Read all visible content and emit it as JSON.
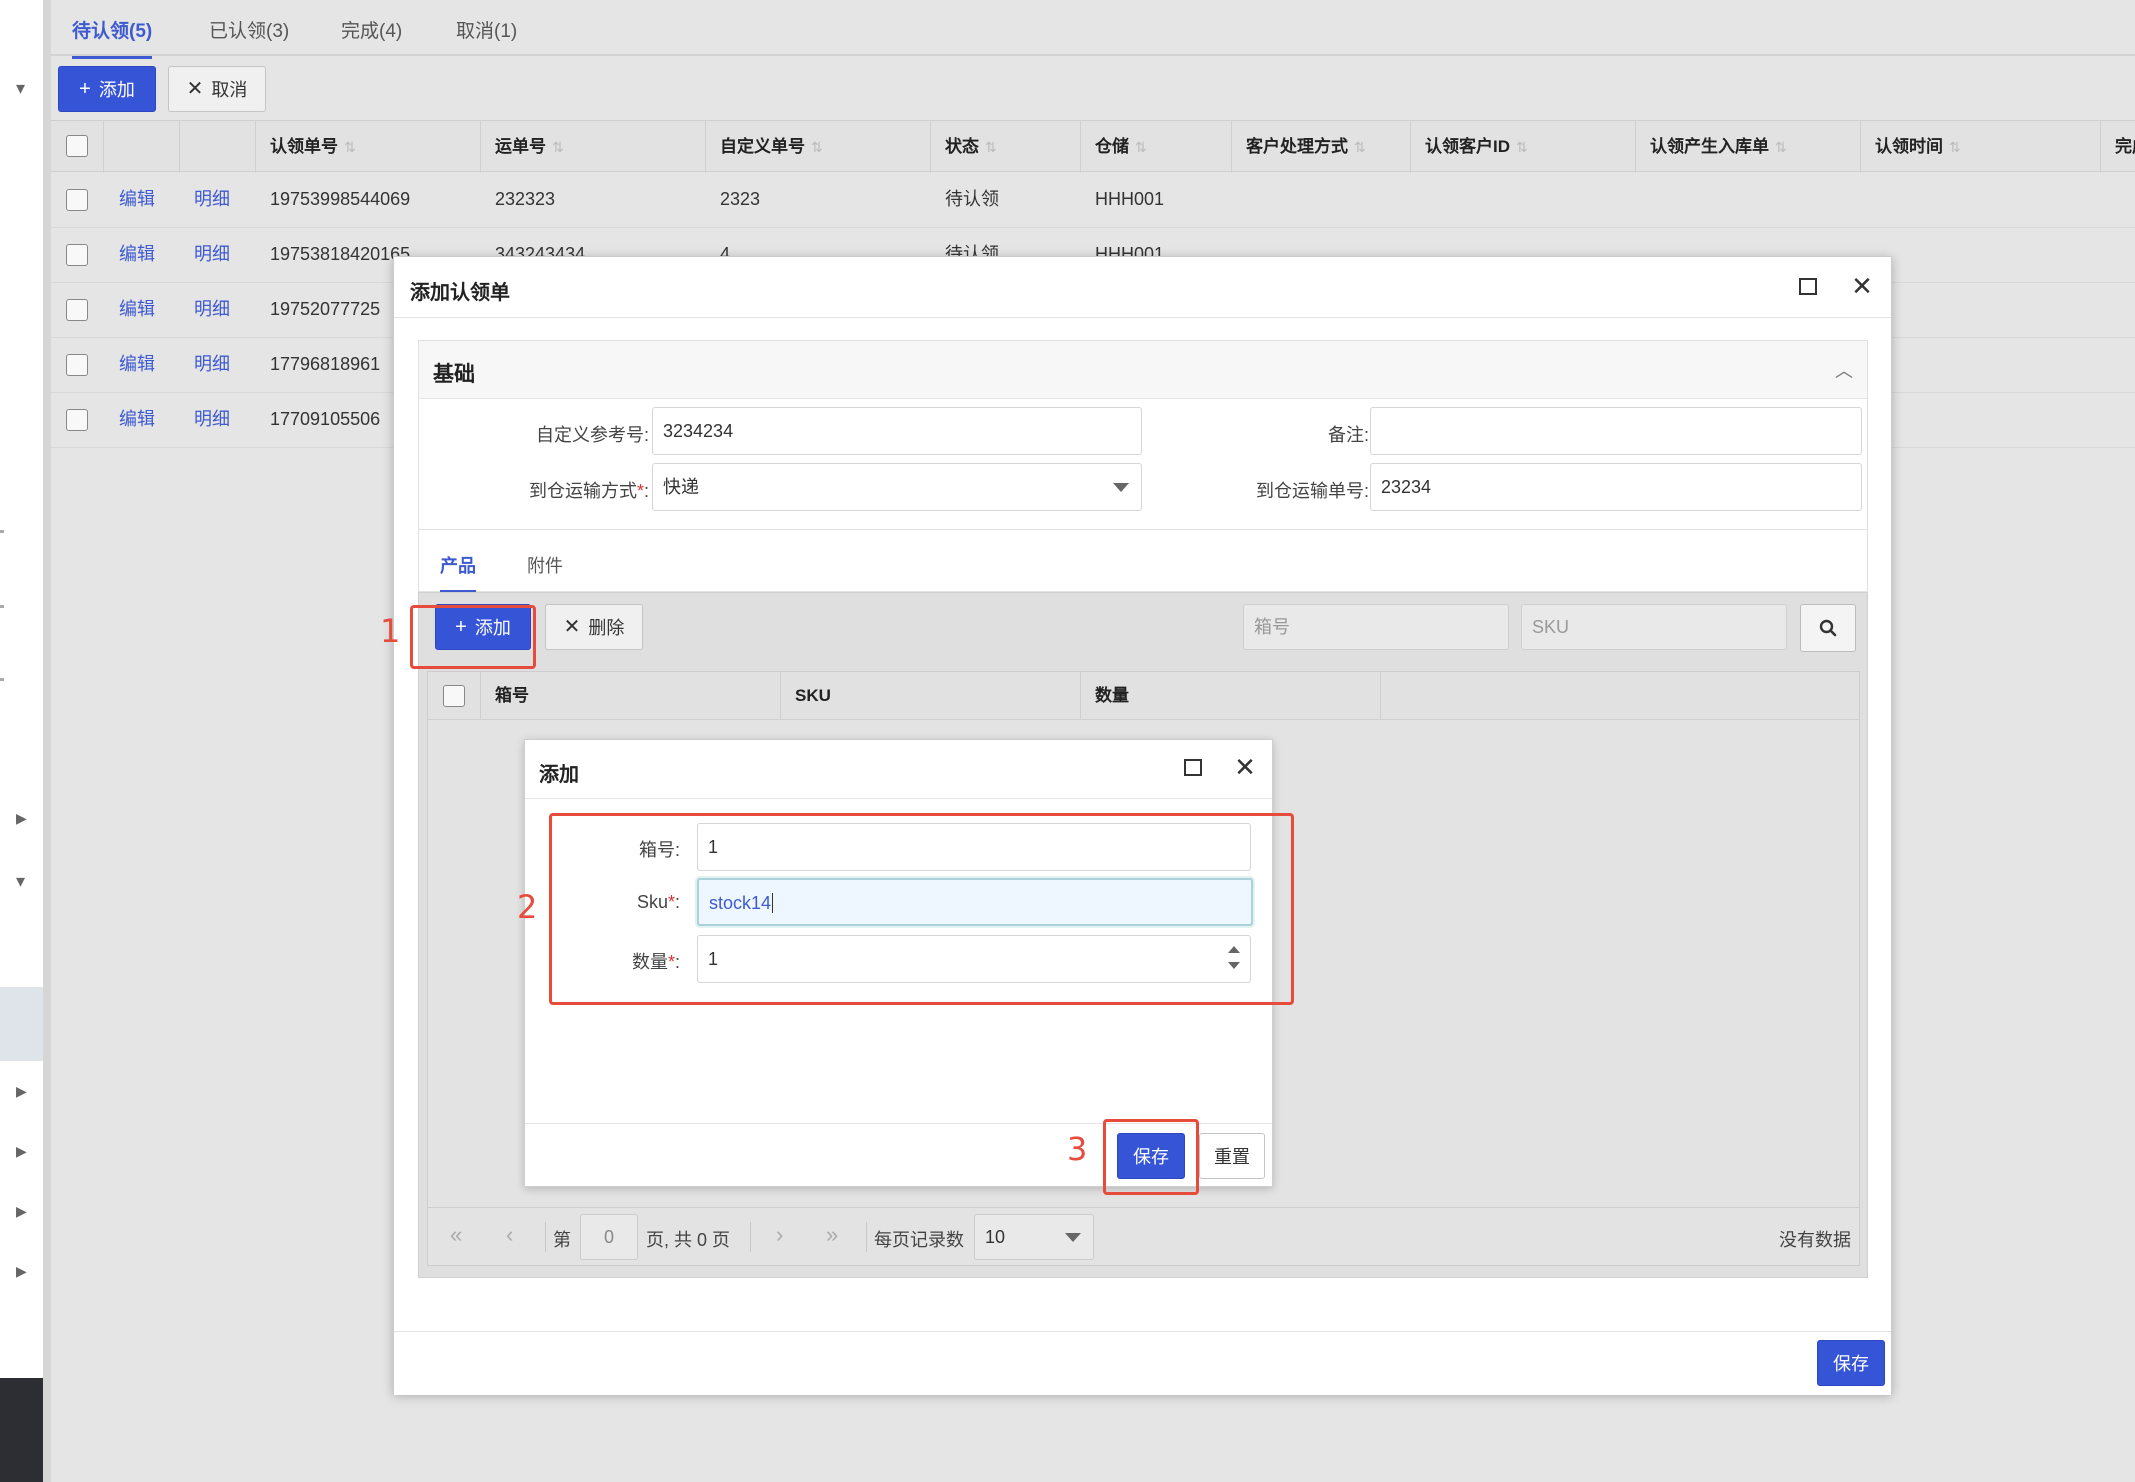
{
  "tabs": [
    {
      "label": "待认领(5)",
      "active": true
    },
    {
      "label": "已认领(3)",
      "active": false
    },
    {
      "label": "完成(4)",
      "active": false
    },
    {
      "label": "取消(1)",
      "active": false
    }
  ],
  "toolbar": {
    "add_label": "添加",
    "cancel_label": "取消"
  },
  "table": {
    "columns": [
      "认领单号",
      "运单号",
      "自定义单号",
      "状态",
      "仓储",
      "客户处理方式",
      "认领客户ID",
      "认领产生入库单",
      "认领时间",
      "完成"
    ],
    "edit_label": "编辑",
    "detail_label": "明细",
    "rows": [
      {
        "id": "19753998544069",
        "waybill": "232323",
        "custom": "2323",
        "status": "待认领",
        "warehouse": "HHH001"
      },
      {
        "id": "19753818420165",
        "waybill": "343243434",
        "custom": "4",
        "status": "待认领",
        "warehouse": "HHH001"
      },
      {
        "id": "19752077725",
        "waybill": "",
        "custom": "",
        "status": "",
        "warehouse": ""
      },
      {
        "id": "17796818961",
        "waybill": "",
        "custom": "",
        "status": "",
        "warehouse": ""
      },
      {
        "id": "17709105506",
        "waybill": "",
        "custom": "",
        "status": "",
        "warehouse": ""
      }
    ]
  },
  "modal": {
    "title": "添加认领单",
    "section_title": "基础",
    "fields": {
      "custom_ref_label": "自定义参考号:",
      "custom_ref_value": "3234234",
      "remark_label": "备注:",
      "remark_value": "",
      "transport_label": "到仓运输方式",
      "transport_value": "快递",
      "transport_no_label": "到仓运输单号:",
      "transport_no_value": "23234"
    },
    "tabs": [
      {
        "label": "产品",
        "active": true
      },
      {
        "label": "附件",
        "active": false
      }
    ],
    "product_toolbar": {
      "add_label": "添加",
      "delete_label": "删除",
      "box_placeholder": "箱号",
      "sku_placeholder": "SKU"
    },
    "product_columns": [
      "箱号",
      "SKU",
      "数量"
    ],
    "pager": {
      "page_prefix": "第",
      "page_value": "0",
      "page_suffix": "页, 共 0 页",
      "per_page_label": "每页记录数",
      "per_page_value": "10",
      "empty_text": "没有数据"
    },
    "save_label": "保存"
  },
  "dialog": {
    "title": "添加",
    "box_label": "箱号:",
    "box_value": "1",
    "sku_label": "Sku",
    "sku_value": "stock14",
    "qty_label": "数量",
    "qty_value": "1",
    "save_label": "保存",
    "reset_label": "重置"
  },
  "annotations": [
    "1",
    "2",
    "3"
  ],
  "colors": {
    "accent": "#3655d6",
    "annotation": "#e64b3c",
    "required": "#e03030"
  }
}
